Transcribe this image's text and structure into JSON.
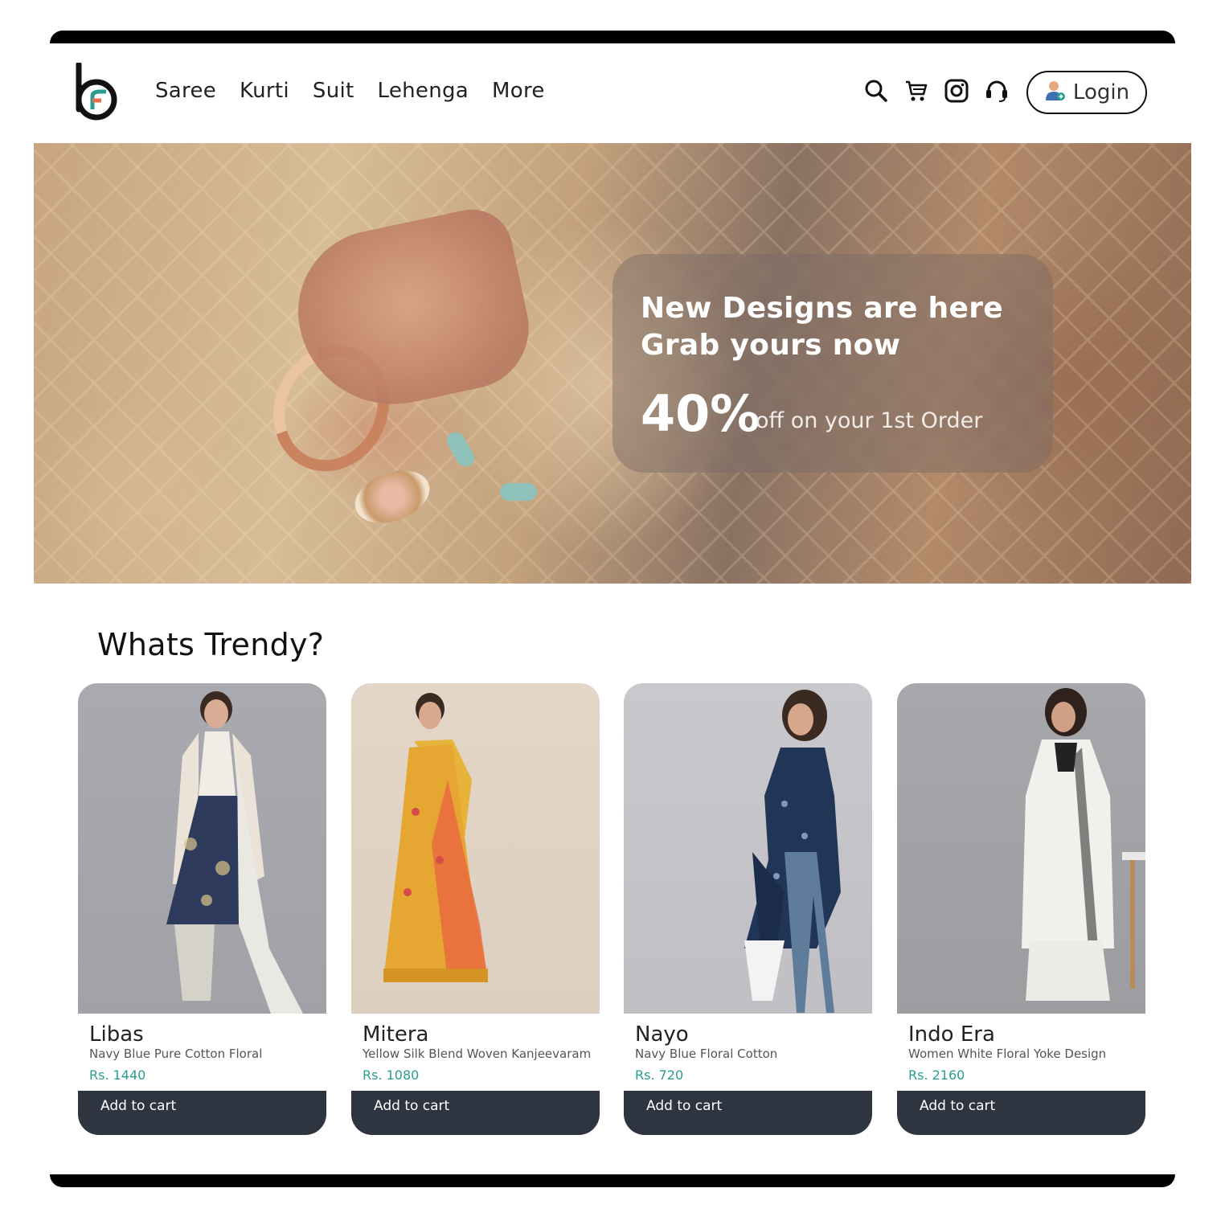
{
  "header": {
    "nav": [
      "Saree",
      "Kurti",
      "Suit",
      "Lehenga",
      "More"
    ],
    "login_label": "Login",
    "icons": [
      "search-icon",
      "cart-icon",
      "instagram-icon",
      "headset-icon",
      "user-icon"
    ]
  },
  "hero": {
    "line1": "New Designs are here",
    "line2": "Grab yours now",
    "discount": "40%",
    "discount_text": "off on your 1st Order"
  },
  "section": {
    "title": "Whats Trendy?"
  },
  "products": [
    {
      "name": "Libas",
      "description": "Navy Blue Pure Cotton Floral",
      "price": "Rs. 1440",
      "button": "Add to cart"
    },
    {
      "name": "Mitera",
      "description": "Yellow Silk Blend Woven Kanjeevaram",
      "price": "Rs. 1080",
      "button": "Add to cart"
    },
    {
      "name": "Nayo",
      "description": "Navy Blue Floral Cotton",
      "price": "Rs. 720",
      "button": "Add to cart"
    },
    {
      "name": "Indo Era",
      "description": "Women White Floral Yoke Design",
      "price": "Rs. 2160",
      "button": "Add to cart"
    }
  ],
  "colors": {
    "accent": "#2a9d8f",
    "button_bg": "#2e3440",
    "text": "#222222"
  }
}
